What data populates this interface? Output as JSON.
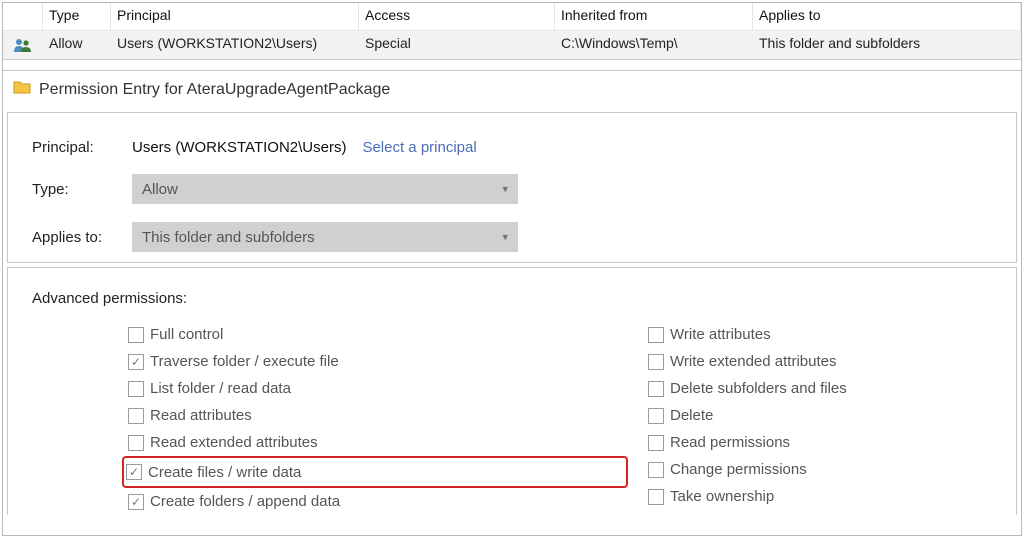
{
  "table": {
    "headers": {
      "type": "Type",
      "principal": "Principal",
      "access": "Access",
      "inherited": "Inherited from",
      "applies": "Applies to"
    },
    "row": {
      "type": "Allow",
      "principal": "Users (WORKSTATION2\\Users)",
      "access": "Special",
      "inherited": "C:\\Windows\\Temp\\",
      "applies": "This folder and subfolders"
    }
  },
  "entry_header": "Permission Entry for AteraUpgradeAgentPackage",
  "form": {
    "principal_label": "Principal:",
    "principal_value": "Users (WORKSTATION2\\Users)",
    "select_principal": "Select a principal",
    "type_label": "Type:",
    "type_value": "Allow",
    "applies_label": "Applies to:",
    "applies_value": "This folder and subfolders"
  },
  "perm": {
    "title": "Advanced permissions:",
    "left": [
      {
        "label": "Full control",
        "checked": false
      },
      {
        "label": "Traverse folder / execute file",
        "checked": true
      },
      {
        "label": "List folder / read data",
        "checked": false
      },
      {
        "label": "Read attributes",
        "checked": false
      },
      {
        "label": "Read extended attributes",
        "checked": false
      },
      {
        "label": "Create files / write data",
        "checked": true
      },
      {
        "label": "Create folders / append data",
        "checked": true
      }
    ],
    "right": [
      {
        "label": "Write attributes",
        "checked": false
      },
      {
        "label": "Write extended attributes",
        "checked": false
      },
      {
        "label": "Delete subfolders and files",
        "checked": false
      },
      {
        "label": "Delete",
        "checked": false
      },
      {
        "label": "Read permissions",
        "checked": false
      },
      {
        "label": "Change permissions",
        "checked": false
      },
      {
        "label": "Take ownership",
        "checked": false
      }
    ]
  }
}
